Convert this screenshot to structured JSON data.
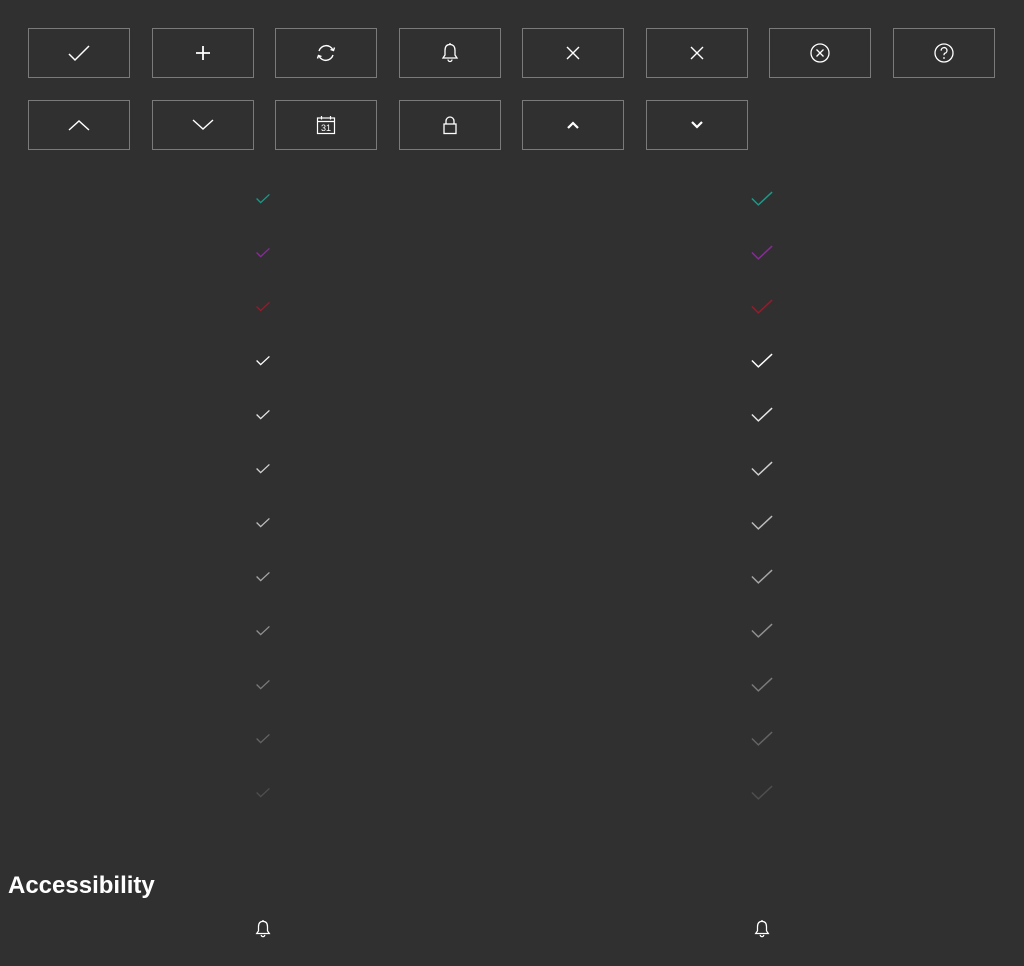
{
  "toolbar_row1": [
    {
      "icon": "check-icon"
    },
    {
      "icon": "plus-icon"
    },
    {
      "icon": "refresh-icon"
    },
    {
      "icon": "bell-icon"
    },
    {
      "icon": "close-icon"
    },
    {
      "icon": "close-icon"
    },
    {
      "icon": "close-circle-icon"
    },
    {
      "icon": "help-circle-icon"
    }
  ],
  "toolbar_row2": [
    {
      "icon": "chevron-up-thin-icon"
    },
    {
      "icon": "chevron-down-thin-icon"
    },
    {
      "icon": "calendar-icon",
      "label": "31"
    },
    {
      "icon": "lock-icon"
    },
    {
      "icon": "chevron-up-bold-icon"
    },
    {
      "icon": "chevron-down-bold-icon"
    }
  ],
  "check_colors": [
    "#1a9a8a",
    "#8a2a9a",
    "#9a1a2a",
    "#ffffff",
    "#e6e6e6",
    "#d0d0d0",
    "#bcbcbc",
    "#a6a6a6",
    "#909090",
    "#7a7a7a",
    "#646464",
    "#4e4e4e"
  ],
  "section": {
    "heading": "Accessibility"
  },
  "accessibility_icons": [
    {
      "icon": "bell-icon"
    },
    {
      "icon": "bell-icon"
    }
  ]
}
